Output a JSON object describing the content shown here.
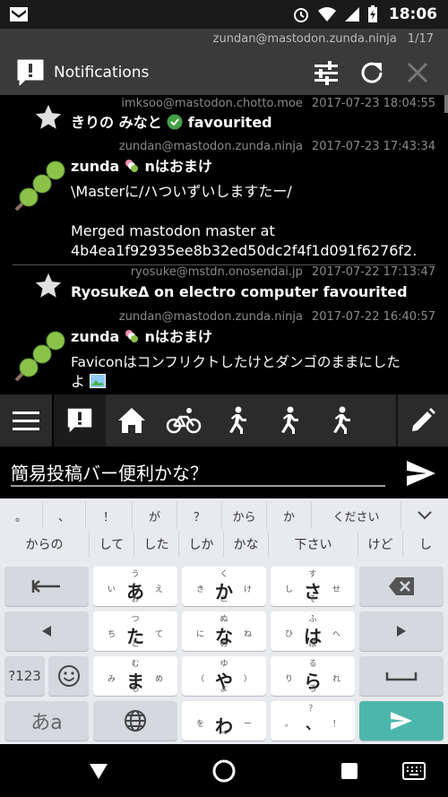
{
  "status": {
    "time": "18:06",
    "battery_icon": "battery-charging-icon",
    "wifi_icon": "wifi-icon",
    "signal_icon": "signal-icon",
    "alarm_icon": "alarm-icon"
  },
  "header": {
    "account": "zundan@mastodon.zunda.ninja",
    "pager": "1/17",
    "title": "Notifications"
  },
  "timeline": [
    {
      "account": "imksoo@mastodon.chotto.moe",
      "time": "2017-07-23 18:04:55",
      "who": "きりの みなと",
      "action": " favourited",
      "kind": "favourite"
    },
    {
      "account": "zundan@mastodon.zunda.ninja",
      "time": "2017-07-23 17:43:34",
      "who": "zunda",
      "handle": "nはおまけ",
      "lines": [
        "\\Masterに/ハついずいしますたー/",
        "",
        "Merged mastodon master at",
        "4b4ea1f92935ee8b32ed50dc2f4f1d091f6276f2."
      ],
      "kind": "toot"
    },
    {
      "account": "ryosuke@mstdn.onosendai.jp",
      "time": "2017-07-22 17:13:47",
      "who": "RyosukeΔ on electro computer",
      "action": " favourited",
      "kind": "favourite"
    },
    {
      "account": "zundan@mastodon.zunda.ninja",
      "time": "2017-07-22 16:40:57",
      "who": "zunda",
      "handle": "nはおまけ",
      "lines": [
        "Faviconはコンフリクトしたけとダンゴのままにした",
        "よ"
      ],
      "kind": "toot"
    }
  ],
  "composer": {
    "text": "簡易投稿バー便利かな？"
  },
  "keyboard": {
    "row1": [
      "。",
      "、",
      "！",
      "が",
      "？",
      "から",
      "か",
      "ください",
      ""
    ],
    "row2": [
      "からの",
      "して",
      "した",
      "しか",
      "かな",
      "下さい",
      "けど",
      "し"
    ],
    "kana": [
      {
        "c": "あ",
        "t": "う",
        "l": "い",
        "r": "え",
        "b": "お"
      },
      {
        "c": "か",
        "t": "く",
        "l": "き",
        "r": "け",
        "b": "こ"
      },
      {
        "c": "さ",
        "t": "す",
        "l": "し",
        "r": "せ",
        "b": "そ"
      },
      {
        "c": "た",
        "t": "つ",
        "l": "ち",
        "r": "て",
        "b": "と"
      },
      {
        "c": "な",
        "t": "ぬ",
        "l": "に",
        "r": "ね",
        "b": "の"
      },
      {
        "c": "は",
        "t": "ふ",
        "l": "ひ",
        "r": "へ",
        "b": "ほ"
      },
      {
        "c": "ま",
        "t": "む",
        "l": "み",
        "r": "め",
        "b": "も"
      },
      {
        "c": "や",
        "t": "ゆ",
        "l": "（",
        "r": "）",
        "b": "よ"
      },
      {
        "c": "ら",
        "t": "る",
        "l": "り",
        "r": "れ",
        "b": "ろ"
      },
      {
        "c": "わ",
        "t": "",
        "l": "を",
        "r": "ー",
        "b": "〜"
      },
      {
        "c": "、",
        "t": "？",
        "l": "。",
        "r": "！",
        "b": ""
      }
    ],
    "num_label": "?123",
    "mode_label": "あa"
  },
  "colors": {
    "accent": "#4db6ac",
    "header": "#3a3a3a",
    "dango_green": "#8bc34a"
  }
}
